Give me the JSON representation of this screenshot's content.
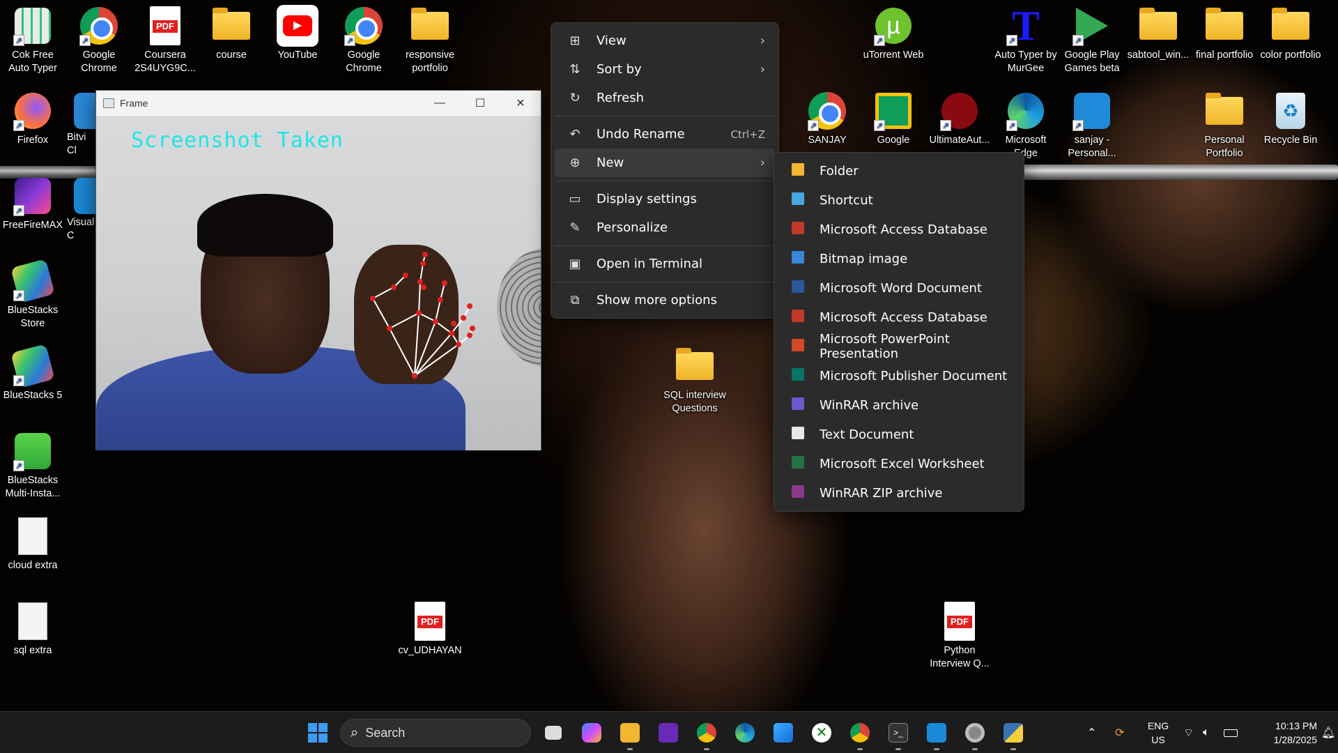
{
  "desktop": {
    "icons": [
      {
        "label": "Cok Free Auto Typer",
        "icon": "cok-free-auto-typer-icon"
      },
      {
        "label": "Google Chrome",
        "icon": "chrome-icon"
      },
      {
        "label": "Coursera 2S4UYG9C...",
        "icon": "pdf-icon"
      },
      {
        "label": "course",
        "icon": "folder-icon"
      },
      {
        "label": "YouTube",
        "icon": "youtube-icon"
      },
      {
        "label": "Google Chrome",
        "icon": "chrome-icon"
      },
      {
        "label": "responsive portfolio",
        "icon": "folder-icon"
      },
      {
        "label": "uTorrent Web",
        "icon": "utorrent-icon"
      },
      {
        "label": "Auto Typer by MurGee",
        "icon": "auto-typer-icon"
      },
      {
        "label": "Google Play Games beta",
        "icon": "google-play-games-icon"
      },
      {
        "label": "sabtool_win...",
        "icon": "folder-icon"
      },
      {
        "label": "final portfolio",
        "icon": "folder-icon"
      },
      {
        "label": "color portfolio",
        "icon": "folder-icon"
      },
      {
        "label": "Firefox",
        "icon": "firefox-icon"
      },
      {
        "label": "Bitvi Cl",
        "icon": "bitvise-icon"
      },
      {
        "label": "SANJAY",
        "icon": "chrome-profile-icon"
      },
      {
        "label": "Google",
        "icon": "google-classroom-icon"
      },
      {
        "label": "UltimateAut...",
        "icon": "ultimate-auto-icon"
      },
      {
        "label": "Microsoft Edge",
        "icon": "edge-icon"
      },
      {
        "label": "sanjay - Personal...",
        "icon": "onedrive-icon"
      },
      {
        "label": "Personal Portfolio",
        "icon": "folder-icon"
      },
      {
        "label": "Recycle Bin",
        "icon": "recycle-bin-icon"
      },
      {
        "label": "FreeFireMAX",
        "icon": "freefire-icon"
      },
      {
        "label": "Visual C",
        "icon": "vscode-icon"
      },
      {
        "label": "BlueStacks Store",
        "icon": "bluestacks-store-icon"
      },
      {
        "label": "BlueStacks 5",
        "icon": "bluestacks-icon"
      },
      {
        "label": "BlueStacks Multi-Insta...",
        "icon": "bluestacks-multi-icon"
      },
      {
        "label": "cloud extra",
        "icon": "text-file-icon"
      },
      {
        "label": "sql extra",
        "icon": "text-file-icon"
      },
      {
        "label": "SQL interview Questions",
        "icon": "folder-icon"
      },
      {
        "label": "cv_UDHAYAN",
        "icon": "pdf-icon"
      },
      {
        "label": "Python Interview Q...",
        "icon": "pdf-icon"
      }
    ]
  },
  "frame_window": {
    "title": "Frame",
    "overlay_text": "Screenshot Taken",
    "minimize": "—",
    "maximize": "☐",
    "close": "✕"
  },
  "context_menu": {
    "items": [
      {
        "label": "View",
        "icon": "view-grid-icon",
        "submenu": true
      },
      {
        "label": "Sort by",
        "icon": "sort-icon",
        "submenu": true
      },
      {
        "label": "Refresh",
        "icon": "refresh-icon"
      },
      {
        "label": "Undo Rename",
        "icon": "undo-icon",
        "shortcut": "Ctrl+Z"
      },
      {
        "label": "New",
        "icon": "new-plus-icon",
        "submenu": true
      },
      {
        "label": "Display settings",
        "icon": "display-settings-icon"
      },
      {
        "label": "Personalize",
        "icon": "personalize-brush-icon"
      },
      {
        "label": "Open in Terminal",
        "icon": "terminal-icon"
      },
      {
        "label": "Show more options",
        "icon": "show-more-options-icon"
      }
    ]
  },
  "new_submenu": {
    "items": [
      {
        "label": "Folder",
        "color": "#f2b632"
      },
      {
        "label": "Shortcut",
        "color": "#4aa8e0"
      },
      {
        "label": "Microsoft Access Database",
        "color": "#c0392b"
      },
      {
        "label": "Bitmap image",
        "color": "#3a86d8"
      },
      {
        "label": "Microsoft Word Document",
        "color": "#2b579a"
      },
      {
        "label": "Microsoft Access Database",
        "color": "#c0392b"
      },
      {
        "label": "Microsoft PowerPoint Presentation",
        "color": "#d24726"
      },
      {
        "label": "Microsoft Publisher Document",
        "color": "#077568"
      },
      {
        "label": "WinRAR archive",
        "color": "#6a5acd"
      },
      {
        "label": "Text Document",
        "color": "#e8e8e8"
      },
      {
        "label": "Microsoft Excel Worksheet",
        "color": "#217346"
      },
      {
        "label": "WinRAR ZIP archive",
        "color": "#8b3a8b"
      }
    ]
  },
  "taskbar": {
    "search_placeholder": "Search",
    "lang_line1": "ENG",
    "lang_line2": "US",
    "time": "10:13 PM",
    "date": "1/28/2025"
  }
}
